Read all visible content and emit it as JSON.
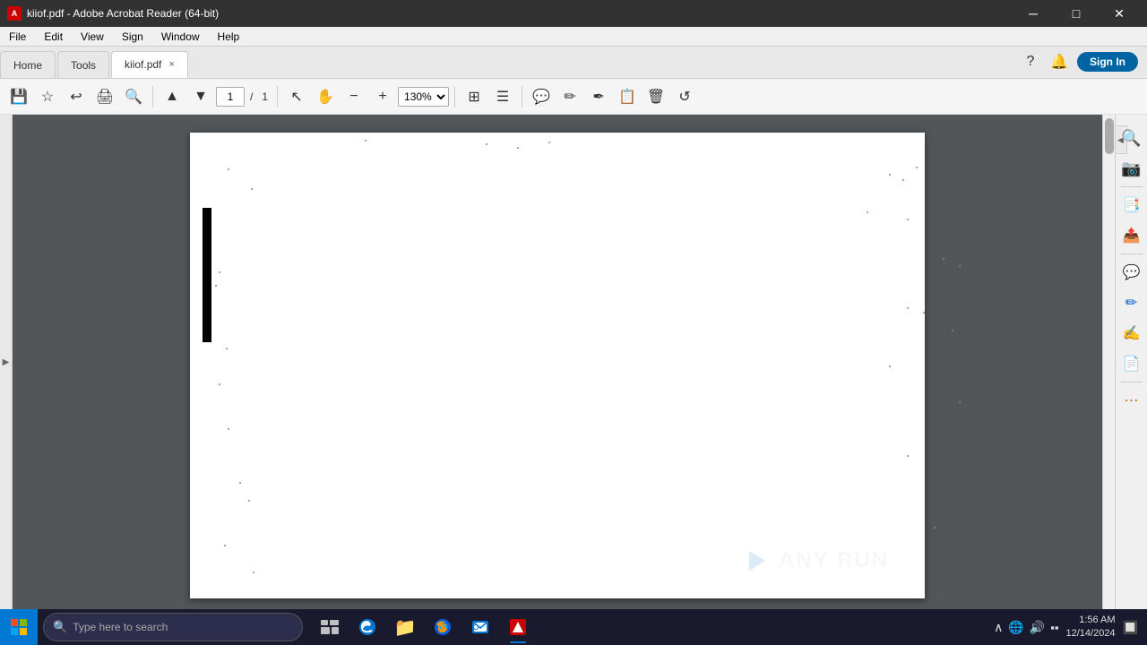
{
  "titlebar": {
    "title": "kiiof.pdf - Adobe Acrobat Reader (64-bit)",
    "icon": "A",
    "min_btn": "─",
    "max_btn": "□",
    "close_btn": "✕"
  },
  "menubar": {
    "items": [
      "File",
      "Edit",
      "View",
      "Sign",
      "Window",
      "Help"
    ]
  },
  "tabs": {
    "home": "Home",
    "tools": "Tools",
    "active_tab": "kiiof.pdf",
    "close_symbol": "×"
  },
  "tab_actions": {
    "help_icon": "?",
    "bell_icon": "🔔",
    "sign_in": "Sign In"
  },
  "toolbar": {
    "save_icon": "💾",
    "bookmark_icon": "☆",
    "back_icon": "↩",
    "print_icon": "🖨",
    "search_icon": "🔍",
    "prev_page_icon": "▲",
    "next_page_icon": "▼",
    "page_current": "1",
    "page_separator": "/",
    "page_total": "1",
    "select_icon": "↖",
    "hand_icon": "✋",
    "zoom_out_icon": "−",
    "zoom_in_icon": "+",
    "zoom_level": "130%",
    "fit_icon": "⊞",
    "scroll_icon": "≡",
    "comment_icon": "💬",
    "highlight_icon": "✏",
    "markup_icon": "✒",
    "stamp_icon": "📋",
    "delete_icon": "🗑",
    "rotate_icon": "↺"
  },
  "right_panel": {
    "search_icon": "🔍",
    "scan_icon": "📷",
    "organize_icon": "📑",
    "export_icon": "📤",
    "comment2_icon": "💬",
    "edit_icon": "✏",
    "fill_icon": "📝",
    "pdf_icon": "📄",
    "more_icon": "⋯"
  },
  "taskbar": {
    "search_placeholder": "Type here to search",
    "search_icon": "🔍",
    "time": "1:56 AM",
    "date": "12/14/2024",
    "apps": [
      {
        "name": "task-view",
        "icon": "⊞",
        "active": false
      },
      {
        "name": "edge",
        "icon": "●",
        "active": false
      },
      {
        "name": "explorer",
        "icon": "📁",
        "active": false
      },
      {
        "name": "firefox",
        "icon": "🦊",
        "active": false
      },
      {
        "name": "outlook",
        "icon": "✉",
        "active": false
      },
      {
        "name": "acrobat",
        "icon": "▲",
        "active": true
      }
    ]
  }
}
